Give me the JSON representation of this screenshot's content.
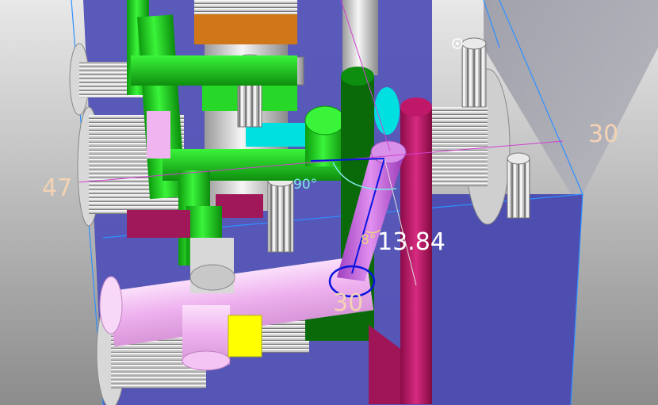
{
  "viewport": {
    "background_top": "#e6e6e6",
    "background_bottom": "#8a8a8a",
    "block_color": "#5a5ab8",
    "block_edge_color": "#3aa0ff"
  },
  "colors": {
    "green": "#1fd01f",
    "dark_green": "#0a6a0a",
    "pink": "#f0b4f0",
    "magenta": "#c0186a",
    "violet": "#c060e0",
    "cyan": "#00e0e0",
    "orange": "#d07818",
    "yellow": "#ffff00",
    "steel": "#c8c8c8",
    "annotation_blue": "#0a14e0",
    "annotation_magenta": "#d040d0"
  },
  "dimensions": {
    "width_right": "30",
    "height_left": "47",
    "depth_bottom": "30",
    "distance": "13.84",
    "angle_right": "90°",
    "angle_tilt": "8°"
  }
}
